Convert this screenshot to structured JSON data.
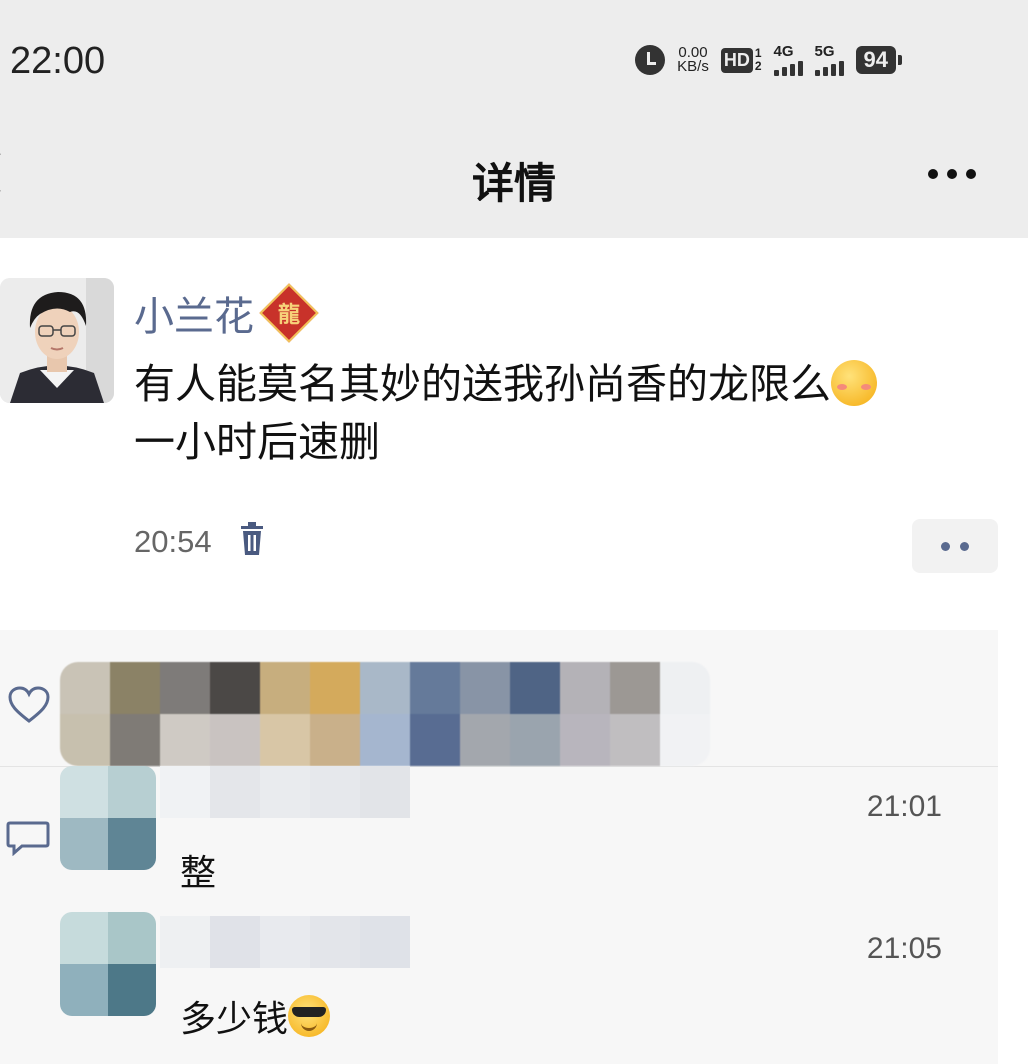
{
  "status_bar": {
    "time": "22:00",
    "net_speed_value": "0.00",
    "net_speed_unit": "KB/s",
    "hd_label": "HD",
    "hd_sub_top": "1",
    "hd_sub_bottom": "2",
    "signal_1_label": "4G",
    "signal_2_label": "5G",
    "battery": "94"
  },
  "nav": {
    "title": "详情"
  },
  "post": {
    "author": "小兰花",
    "badge_char": "龍",
    "text_line1": "有人能莫名其妙的送我孙尚香的龙限么",
    "text_line2": "一小时后速删",
    "time": "20:54"
  },
  "comments": [
    {
      "time": "21:01",
      "text": "整"
    },
    {
      "time": "21:05",
      "text": "多少钱"
    }
  ],
  "colors": {
    "author_name": "#5a6a8f",
    "bar_background": "#ededed",
    "panel_background": "#f7f7f7"
  }
}
